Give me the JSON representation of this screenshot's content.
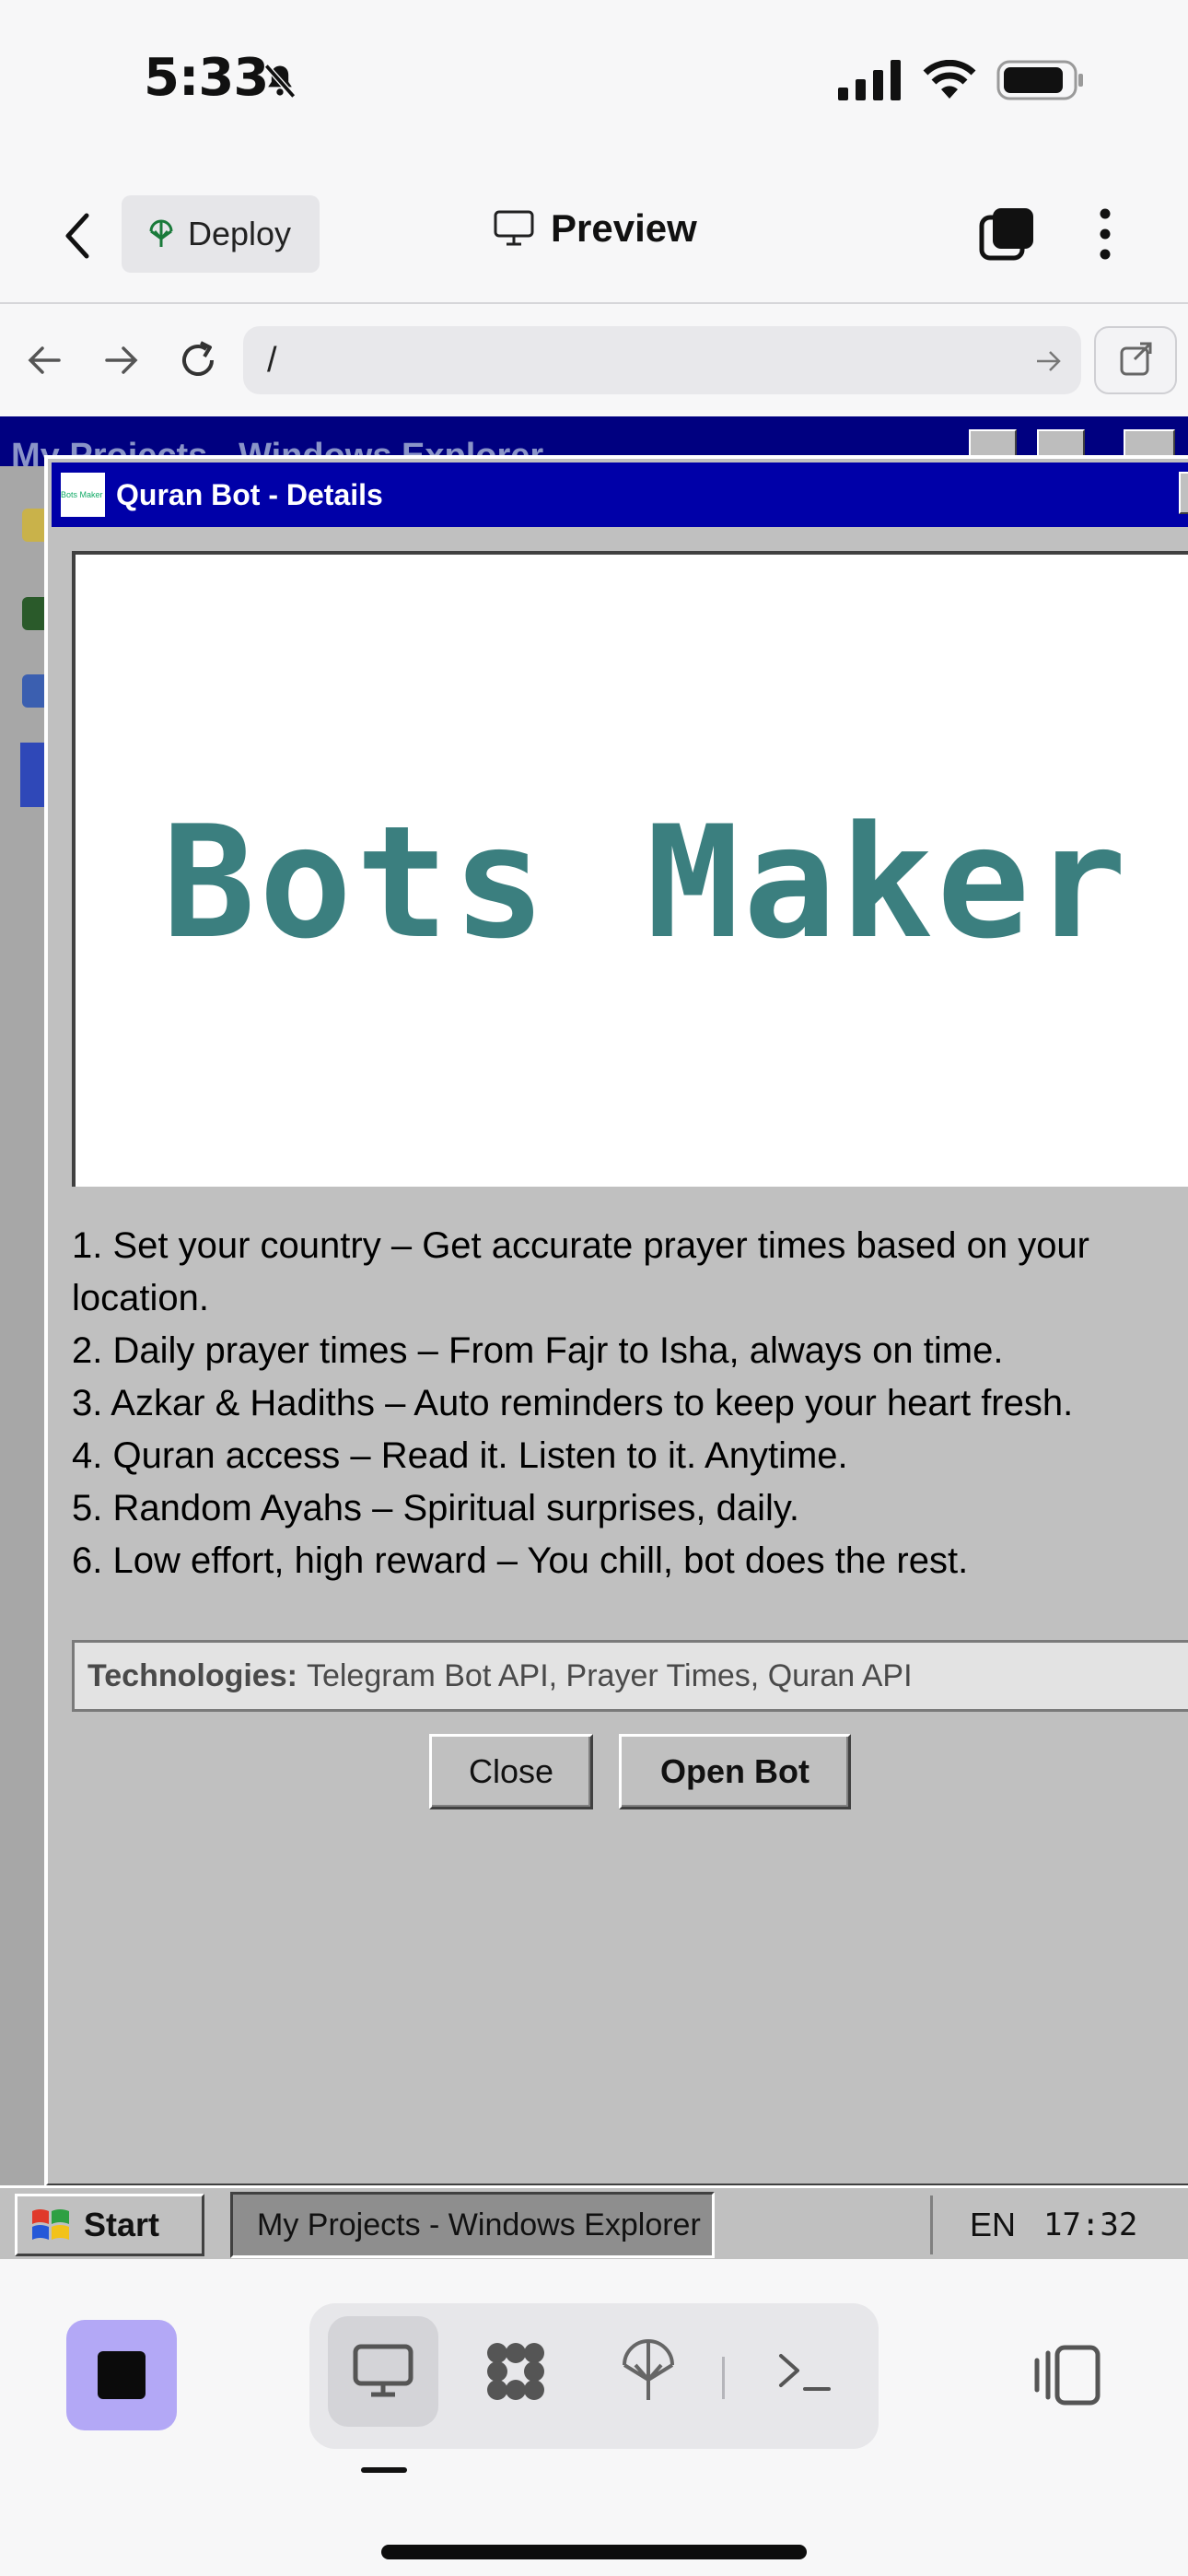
{
  "status_bar": {
    "time": "5:33"
  },
  "app_header": {
    "deploy_label": "Deploy",
    "preview_label": "Preview"
  },
  "browser": {
    "url": "/"
  },
  "background_window": {
    "title": "My Projects - Windows Explorer"
  },
  "dialog": {
    "title": "Quran Bot - Details",
    "icon_text": "Bots Maker",
    "banner_text": "Bots Maker",
    "features": [
      "1. Set your country – Get accurate prayer times based on your location.",
      "2. Daily prayer times – From Fajr to Isha, always on time.",
      "3. Azkar & Hadiths – Auto reminders to keep your heart fresh.",
      "4. Quran access – Read it. Listen to it. Anytime.",
      "5. Random Ayahs – Spiritual surprises, daily.",
      "6. Low effort, high reward – You chill, bot does the rest."
    ],
    "technologies_label": "Technologies:",
    "technologies_value": "Telegram Bot API, Prayer Times, Quran API",
    "close_label": "Close",
    "open_label": "Open Bot"
  },
  "taskbar": {
    "start_label": "Start",
    "task_item": "My Projects - Windows Explorer",
    "language": "EN",
    "clock": "17:32"
  },
  "bottom_toolbar": {
    "icons": [
      "stop-icon",
      "desktop-icon",
      "apps-icon",
      "deploy-icon",
      "terminal-icon",
      "split-view-icon"
    ]
  },
  "colors": {
    "dialog_titlebar": "#0000a8",
    "banner_text": "#3b7f7f",
    "stop_button": "#b3a8f6",
    "win95_gray": "#c0c0c0"
  }
}
